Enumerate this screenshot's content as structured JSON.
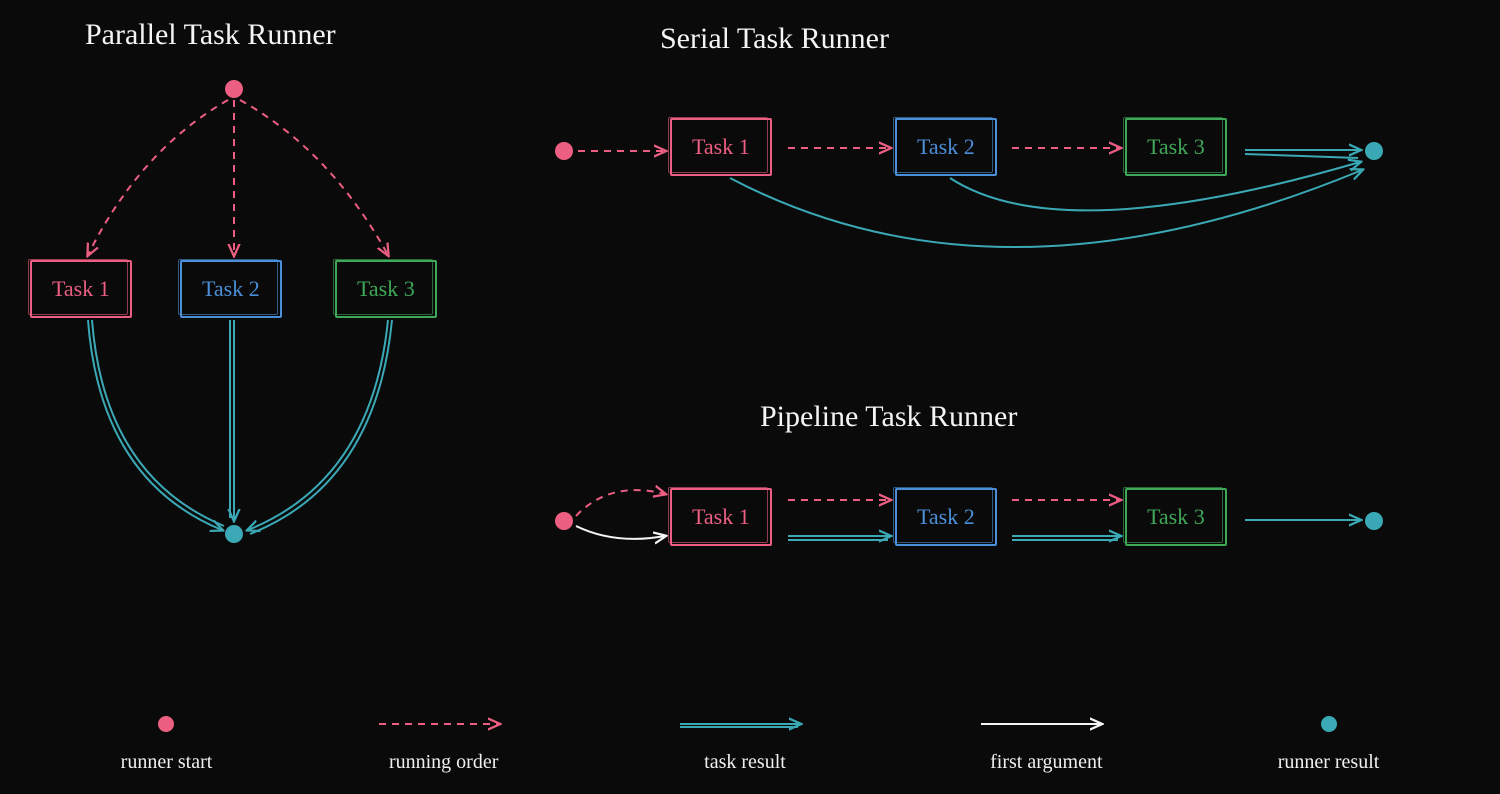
{
  "titles": {
    "parallel": "Parallel Task Runner",
    "serial": "Serial Task Runner",
    "pipeline": "Pipeline Task Runner"
  },
  "tasks": {
    "t1": "Task 1",
    "t2": "Task 2",
    "t3": "Task 3"
  },
  "legend": {
    "runner_start": "runner start",
    "running_order": "running order",
    "task_result": "task result",
    "first_argument": "first argument",
    "runner_result": "runner result"
  },
  "colors": {
    "pink": "#ec5f82",
    "blue": "#4a8fd8",
    "green": "#3fa858",
    "teal": "#3aa8b5",
    "white": "#f5f5f5",
    "bg": "#0a0a0a"
  }
}
